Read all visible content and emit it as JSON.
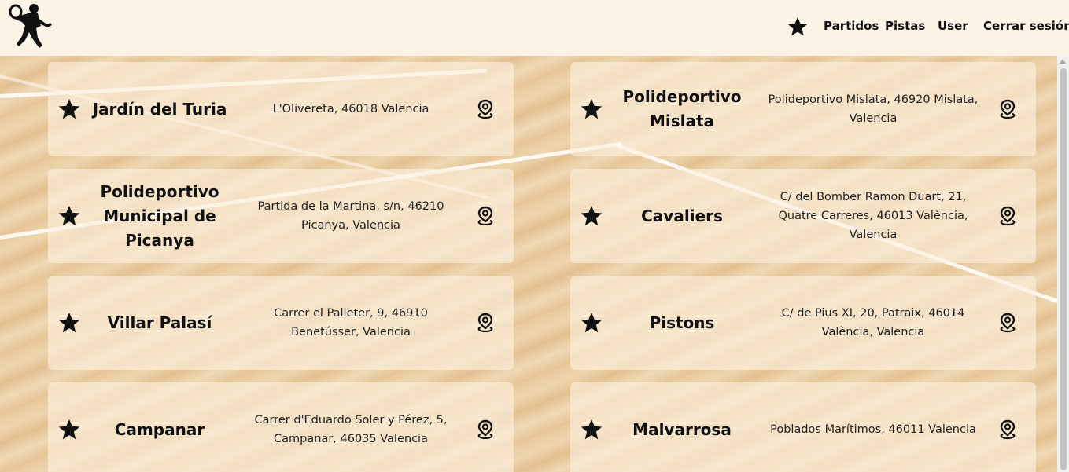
{
  "navbar": {
    "logo_icon": "tennis-player-silhouette-icon",
    "favorites_icon": "star-icon",
    "links": [
      "Partidos",
      "Pistas",
      "User",
      "Cerrar sesión"
    ]
  },
  "courts": [
    {
      "name": "Jardín del Turia",
      "address": "L'Olivereta, 46018 Valencia"
    },
    {
      "name": "Polideportivo Mislata",
      "address": "Polideportivo Mislata, 46920 Mislata, Valencia"
    },
    {
      "name": "Polideportivo Municipal de Picanya",
      "address": "Partida de la Martina, s/n, 46210 Picanya, Valencia"
    },
    {
      "name": "Cavaliers",
      "address": "C/ del Bomber Ramon Duart, 21, Quatre Carreres, 46013 València, Valencia"
    },
    {
      "name": "Villar Palasí",
      "address": "Carrer el Palleter, 9, 46910 Benetússer, Valencia"
    },
    {
      "name": "Pistons",
      "address": "C/ de Pius XI, 20, Patraix, 46014 València, Valencia"
    },
    {
      "name": "Campanar",
      "address": "Carrer d'Eduardo Soler y Pérez, 5, Campanar, 46035 Valencia"
    },
    {
      "name": "Malvarrosa",
      "address": "Poblados Marítimos, 46011 Valencia"
    }
  ],
  "card_icons": {
    "favorite": "star-icon",
    "location": "map-pin-icon"
  }
}
